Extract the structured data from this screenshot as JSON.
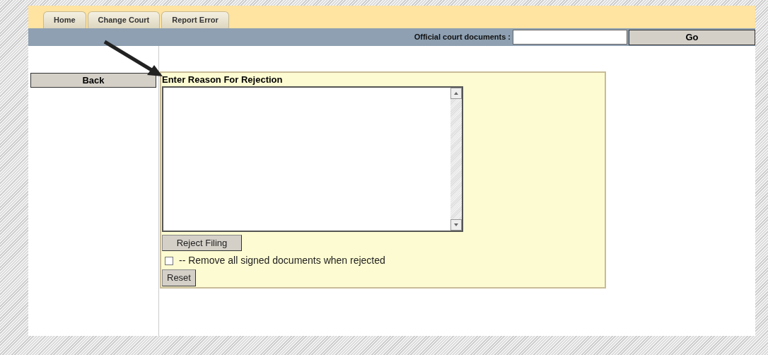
{
  "tabs": [
    {
      "label": "Home"
    },
    {
      "label": "Change Court"
    },
    {
      "label": "Report Error"
    }
  ],
  "search": {
    "label": "Official court documents :",
    "button": "Go"
  },
  "back_button": "Back",
  "form": {
    "title": "Enter Reason For Rejection",
    "reject_button": "Reject Filing",
    "remove_option": {
      "label": "-- Remove all signed documents when rejected",
      "checked": false
    },
    "reset_button": "Reset"
  }
}
